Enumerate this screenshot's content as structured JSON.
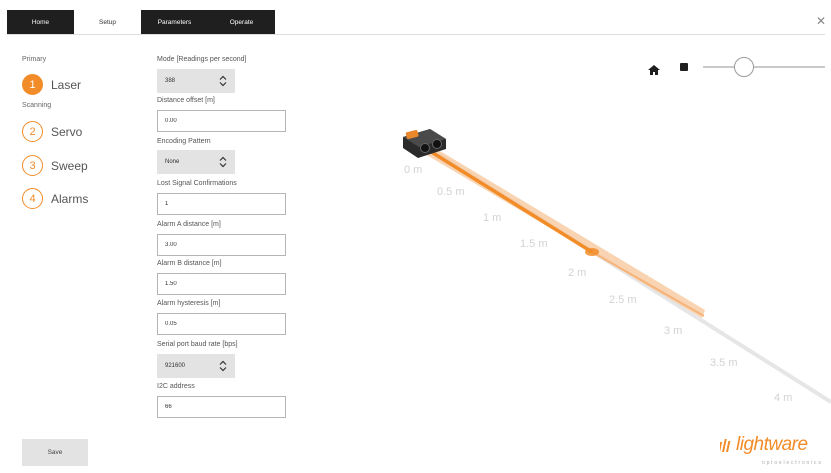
{
  "tabs": [
    {
      "label": "Home",
      "active": false
    },
    {
      "label": "Setup",
      "active": true
    },
    {
      "label": "Parameters",
      "active": false
    },
    {
      "label": "Operate",
      "active": false
    }
  ],
  "sidebar": {
    "primary_label": "Primary",
    "scanning_label": "Scanning",
    "steps": [
      {
        "number": "1",
        "label": "Laser",
        "active": true
      },
      {
        "number": "2",
        "label": "Servo",
        "active": false
      },
      {
        "number": "3",
        "label": "Sweep",
        "active": false
      },
      {
        "number": "4",
        "label": "Alarms",
        "active": false
      }
    ],
    "save_label": "Save"
  },
  "form": {
    "mode": {
      "label": "Mode [Readings per second]",
      "value": "388"
    },
    "distance_offset": {
      "label": "Distance offset [m]",
      "value": "0.00"
    },
    "encoding_pattern": {
      "label": "Encoding Pattern",
      "value": "None"
    },
    "lost_signal": {
      "label": "Lost Signal Confirmations",
      "value": "1"
    },
    "alarm_a": {
      "label": "Alarm A distance [m]",
      "value": "3.00"
    },
    "alarm_b": {
      "label": "Alarm B distance [m]",
      "value": "1.50"
    },
    "alarm_hysteresis": {
      "label": "Alarm hysteresis [m]",
      "value": "0.05"
    },
    "baud_rate": {
      "label": "Serial port baud rate [bps]",
      "value": "921600"
    },
    "i2c_address": {
      "label": "I2C address",
      "value": "66"
    }
  },
  "view": {
    "distance_labels": [
      "0 m",
      "0.5 m",
      "1 m",
      "1.5 m",
      "2 m",
      "2.5 m",
      "3 m",
      "3.5 m",
      "4 m"
    ],
    "playback_position": 0.3,
    "accent_color": "#f28c28",
    "icons": [
      "home-icon",
      "stop-icon",
      "close-icon"
    ]
  },
  "logo": {
    "wordmark": "lightware",
    "tagline": "optoelectronics"
  }
}
